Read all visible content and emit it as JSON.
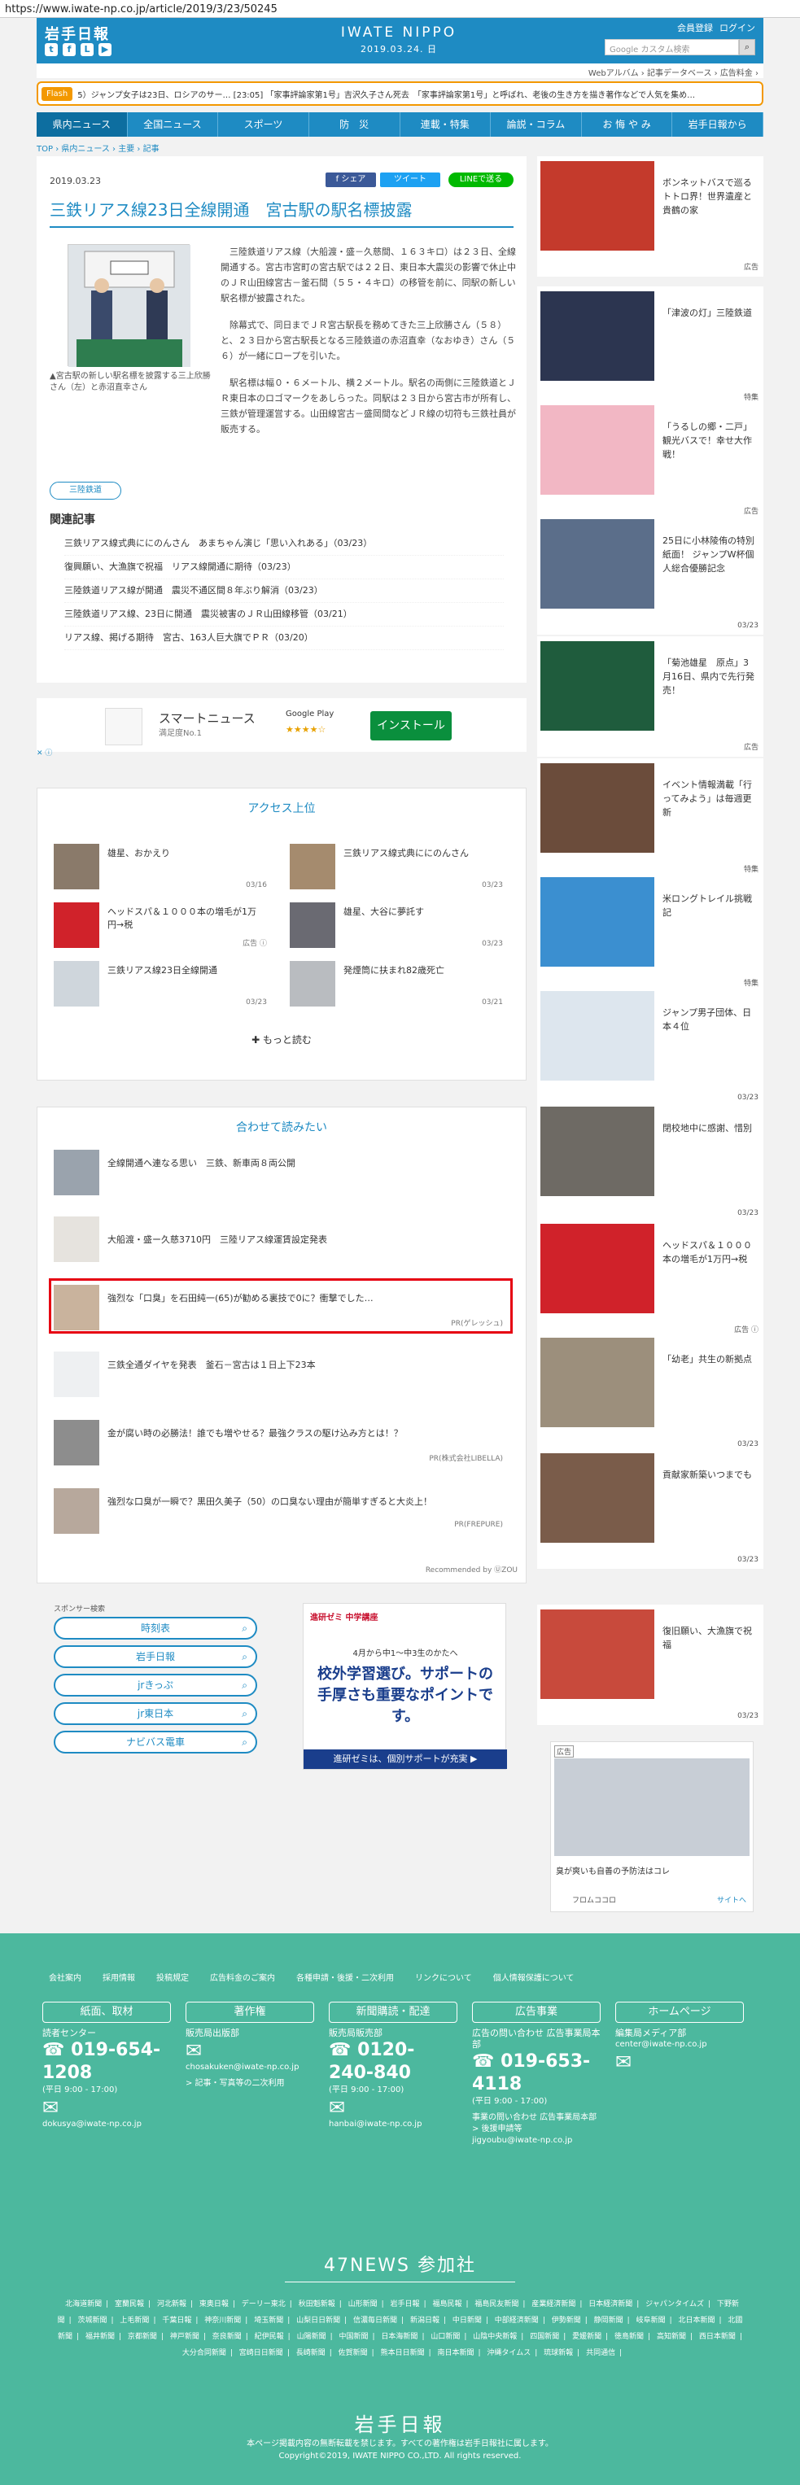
{
  "browser": {
    "url": "https://www.iwate-np.co.jp/article/2019/3/23/50245"
  },
  "header": {
    "logo": "岩手日報",
    "brand": "IWATE NIPPO",
    "date": "2019.03.24. 日",
    "links": [
      "会員登録",
      "ログイン"
    ],
    "search_placeholder": "Google カスタム検索",
    "social": [
      "t",
      "f",
      "L",
      "▶"
    ]
  },
  "subnav": {
    "items": [
      "Webアルバム",
      "記事データベース",
      "広告料金"
    ]
  },
  "flash": {
    "tag": "Flash",
    "text": "5）ジャンプ女子は23日、ロシアのサー… [23:05] 「家事評論家第1号」吉沢久子さん死去　「家事評論家第1号」と呼ばれ、老後の生き方を描き著作などで人気を集め…"
  },
  "gnav": {
    "items": [
      "県内ニュース",
      "全国ニュース",
      "スポーツ",
      "防　災",
      "連載・特集",
      "論説・コラム",
      "お 悔 や み",
      "岩手日報から"
    ]
  },
  "breadcrumb": "TOP › 県内ニュース › 主要 › 記事",
  "article": {
    "date": "2019.03.23",
    "share": {
      "facebook": "f シェア",
      "twitter": "ツイート",
      "line": "LINEで送る"
    },
    "title": "三鉄リアス線23日全線開通　宮古駅の駅名標披露",
    "caption": "▲宮古駅の新しい駅名標を披露する三上欣勝さん（左）と赤沼直幸さん",
    "paragraphs": [
      "三陸鉄道リアス線（大船渡・盛－久慈間、１６３キロ）は２３日、全線開通する。宮古市宮町の宮古駅では２２日、東日本大震災の影響で休止中のＪＲ山田線宮古－釜石間（５５・４キロ）の移管を前に、同駅の新しい駅名標が披露された。",
      "除幕式で、同日までＪＲ宮古駅長を務めてきた三上欣勝さん（５８）と、２３日から宮古駅長となる三陸鉄道の赤沼直幸（なおゆき）さん（５６）が一緒にロープを引いた。",
      "駅名標は幅０・６メートル、横２メートル。駅名の両側に三陸鉄道とＪＲ東日本のロゴマークをあしらった。同駅は２３日から宮古市が所有し、三鉄が管理運営する。山田線宮古－盛岡間などＪＲ線の切符も三鉄社員が販売する。"
    ],
    "tag": "三陸鉄道",
    "related_heading": "関連記事",
    "related": [
      "三鉄リアス線式典ににのんさん　あまちゃん演じ「思い入れある」（03/23）",
      "復興願い、大漁旗で祝福　リアス線開通に期待（03/23）",
      "三陸鉄道リアス線が開通　震災不通区間８年ぶり解消（03/23）",
      "三陸鉄道リアス線、23日に開通　震災被害のＪＲ山田線移管（03/21）",
      "リアス線、掲げる期待　宮古、163人巨大旗でＰＲ（03/20）"
    ]
  },
  "app_ad": {
    "name": "スマートニュース",
    "sub": "満足度No.1",
    "store": "Google Play",
    "stars": "★★★★☆",
    "install": "インストール"
  },
  "access_ranking": {
    "heading": "アクセス上位",
    "items": [
      {
        "title": "雄星、おかえり",
        "date": "03/16"
      },
      {
        "title": "三鉄リアス線式典ににのんさん",
        "date": "03/23"
      },
      {
        "title": "ヘッドスパ＆１０００本の増毛が1万円→税",
        "date": "広告 ⓘ"
      },
      {
        "title": "雄星、大谷に夢託す",
        "date": "03/23"
      },
      {
        "title": "三鉄リアス線23日全線開通",
        "date": "03/23"
      },
      {
        "title": "発煙筒に扶まれ82歳死亡",
        "date": "03/21"
      }
    ],
    "more": "✚ もっと読む"
  },
  "recommend": {
    "heading": "合わせて読みたい",
    "items": [
      {
        "title": "全線開通へ連なる思い　三鉄、新車両８両公開",
        "pr": ""
      },
      {
        "title": "大船渡・盛ー久慈3710円　三陸リアス線運賃設定発表",
        "pr": ""
      },
      {
        "title": "強烈な「口臭」を石田純一(65)が勧める裏技で0に？衝撃でした…",
        "pr": "PR(ゲレッシュ)"
      },
      {
        "title": "三鉄全通ダイヤを発表　釜石－宮古は１日上下23本",
        "pr": ""
      },
      {
        "title": "金が腐い時の必勝法！誰でも増やせる？最強クラスの駆け込み方とは！？",
        "pr": "PR(株式会社LIBELLA)"
      },
      {
        "title": "強烈な口臭が一瞬で？黒田久美子（50）の口臭ない理由が簡単すぎると大炎上！",
        "pr": "PR(FREPURE)"
      }
    ],
    "credit": "Recommended by ⓊZOU"
  },
  "sponsor": {
    "label": "スポンサー検索",
    "keywords": [
      "時刻表",
      "岩手日報",
      "jrきっぷ",
      "jr東日本",
      "ナビバス電車"
    ]
  },
  "banner_ad": {
    "brand": "進研ゼミ 中学講座",
    "line1": "4月から中1〜中3生のかたへ",
    "headline": "校外学習選び。サポートの手厚さも重要なポイントです。",
    "footer": "進研ゼミは、個別サポートが充実 ▶"
  },
  "sidebar": {
    "items": [
      {
        "title": "ボンネットバスで巡るトトロ界！世界遺産と貴鶴の家",
        "tag": "広告"
      },
      {
        "title": "「津波の灯」三陸鉄道",
        "tag": "特集"
      },
      {
        "title": "「うるしの郷・二戸」観光バスで！幸せ大作戦！",
        "tag": "広告"
      },
      {
        "title": "25日に小林陵侑の特別紙面！ ジャンプW杯個人総合優勝記念",
        "tag": "03/23"
      },
      {
        "title": "「菊池雄星　原点」3月16日、県内で先行発売！",
        "tag": "広告"
      },
      {
        "title": "イベント情報満載「行ってみよう」は毎週更新",
        "tag": "特集"
      },
      {
        "title": "米ロングトレイル挑戦記",
        "tag": "特集"
      },
      {
        "title": "ジャンプ男子団体、日本４位",
        "tag": "03/23"
      },
      {
        "title": "閉校地中に感謝、惜別",
        "tag": "03/23"
      },
      {
        "title": "ヘッドスパ＆１０００本の増毛が1万円→税",
        "tag": "広告 ⓘ"
      },
      {
        "title": "「幼老」共生の新拠点",
        "tag": "03/23"
      },
      {
        "title": "貢献家新築いつまでも",
        "tag": "03/23"
      },
      {
        "title": "復旧願い、大漁旗で祝福",
        "tag": "03/23"
      }
    ],
    "ad": {
      "label": "広告",
      "text": "臭が爽いも自善の予防法はコレ",
      "brand": "フロムココロ",
      "site": "サイトへ"
    }
  },
  "footer": {
    "links": [
      "会社案内",
      "採用情報",
      "投稿規定",
      "広告料金のご案内",
      "各種申請・後援・二次利用",
      "リンクについて",
      "個人情報保護について"
    ],
    "columns": [
      {
        "head": "紙面、取材",
        "label": "読者センター",
        "tel": "019-654-1208",
        "hours": "(平日 9:00 - 17:00)",
        "mail": "dokusya@iwate-np.co.jp",
        "extra": ""
      },
      {
        "head": "著作権",
        "label": "販売局出版部",
        "tel": "",
        "hours": "",
        "mail": "chosakuken@iwate-np.co.jp",
        "extra": "> 記事・写真等の二次利用"
      },
      {
        "head": "新聞購読・配達",
        "label": "販売局販売部",
        "tel": "0120-240-840",
        "hours": "(平日 9:00 - 17:00)",
        "mail": "hanbai@iwate-np.co.jp",
        "extra": ""
      },
      {
        "head": "広告事業",
        "label": "広告の問い合わせ 広告事業局本部",
        "tel": "019-653-4118",
        "hours": "(平日 9:00 - 17:00)",
        "mail": "jigyoubu@iwate-np.co.jp",
        "extra": "事業の問い合わせ 広告事業局本部 > 後援申請等"
      },
      {
        "head": "ホームページ",
        "label": "編集局メディア部",
        "tel": "",
        "hours": "",
        "mail": "center@iwate-np.co.jp",
        "extra": ""
      }
    ],
    "news47": "47NEWS 参加社",
    "papers": [
      "北海道新聞",
      "室蘭民報",
      "河北新報",
      "東奥日報",
      "デーリー東北",
      "秋田魁新報",
      "山形新聞",
      "岩手日報",
      "福島民報",
      "福島民友新聞",
      "産業経済新聞",
      "日本経済新聞",
      "ジャパンタイムズ",
      "下野新聞",
      "茨城新聞",
      "上毛新聞",
      "千葉日報",
      "神奈川新聞",
      "埼玉新聞",
      "山梨日日新聞",
      "信濃毎日新聞",
      "新潟日報",
      "中日新聞",
      "中部経済新聞",
      "伊勢新聞",
      "静岡新聞",
      "岐阜新聞",
      "北日本新聞",
      "北國新聞",
      "福井新聞",
      "京都新聞",
      "神戸新聞",
      "奈良新聞",
      "紀伊民報",
      "山陽新聞",
      "中国新聞",
      "日本海新聞",
      "山口新聞",
      "山陰中央新報",
      "四国新聞",
      "愛媛新聞",
      "徳島新聞",
      "高知新聞",
      "西日本新聞",
      "大分合同新聞",
      "宮崎日日新聞",
      "長崎新聞",
      "佐賀新聞",
      "熊本日日新聞",
      "南日本新聞",
      "沖縄タイムス",
      "琉球新報",
      "共同通信"
    ],
    "logo": "岩手日報",
    "copy1": "本ページ掲載内容の無断転載を禁じます。すべての著作権は岩手日報社に属します。",
    "copy2": "Copyright©2019, IWATE NIPPO CO.,LTD. All rights reserved."
  }
}
